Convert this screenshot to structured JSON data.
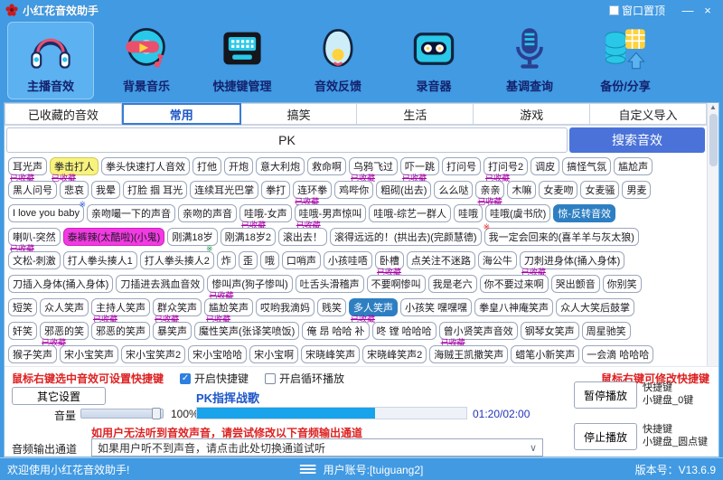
{
  "window": {
    "title": "小红花音效助手",
    "pin_label": "窗口置顶",
    "minimize_label": "—",
    "close_label": "×"
  },
  "toolbar": {
    "items": [
      {
        "label": "主播音效"
      },
      {
        "label": "背景音乐"
      },
      {
        "label": "快捷键管理"
      },
      {
        "label": "音效反馈"
      },
      {
        "label": "录音器"
      },
      {
        "label": "基调查询"
      },
      {
        "label": "备份/分享"
      }
    ]
  },
  "tabs": {
    "items": [
      {
        "label": "已收藏的音效"
      },
      {
        "label": "常用"
      },
      {
        "label": "搞笑"
      },
      {
        "label": "生活"
      },
      {
        "label": "游戏"
      },
      {
        "label": "自定义导入"
      }
    ],
    "active": "常用"
  },
  "search": {
    "value": "PK",
    "button_label": "搜索音效"
  },
  "sound_grid": {
    "badge_label": "已收藏",
    "rows": [
      [
        {
          "t": "耳光声",
          "badge": true
        },
        {
          "t": "拳击打人",
          "badge": true,
          "hl": "yellow"
        },
        {
          "t": "拳头快速打人音效"
        },
        {
          "t": "打他"
        },
        {
          "t": "开炮"
        },
        {
          "t": "意大利炮"
        },
        {
          "t": "救命啊"
        },
        {
          "t": "乌鸦飞过",
          "badge": true
        },
        {
          "t": "吓一跳",
          "badge": true
        },
        {
          "t": "打问号"
        },
        {
          "t": "打问号2",
          "badge": true
        },
        {
          "t": "调皮"
        },
        {
          "t": "搞怪气氛"
        },
        {
          "t": "尴尬声"
        }
      ],
      [
        {
          "t": "黑人问号"
        },
        {
          "t": "悲哀"
        },
        {
          "t": "我晕"
        },
        {
          "t": "打脸 掴 耳光"
        },
        {
          "t": "连续耳光巴掌"
        },
        {
          "t": "拳打"
        },
        {
          "t": "连环拳",
          "badge": true
        },
        {
          "t": "鸡哔你"
        },
        {
          "t": "粗砌(出去)"
        },
        {
          "t": "么么哒"
        },
        {
          "t": "亲亲",
          "badge": true
        },
        {
          "t": "木嘛"
        },
        {
          "t": "女麦吻"
        },
        {
          "t": "女麦骚"
        },
        {
          "t": "男麦"
        }
      ],
      [
        {
          "t": "I love you baby",
          "mark": "blue"
        },
        {
          "t": "亲吻嘬一下的声音"
        },
        {
          "t": "亲吻的声音"
        },
        {
          "t": "哇哦-女声",
          "badge": true
        },
        {
          "t": "哇哦-男声惊叫",
          "badge": true
        },
        {
          "t": "哇哦-综艺一群人"
        },
        {
          "t": "哇哦"
        },
        {
          "t": "哇哦(虞书欣)"
        },
        {
          "t": "惊-反转音效",
          "hl": "blue"
        }
      ],
      [
        {
          "t": "喇叭-突然",
          "badge": true
        },
        {
          "t": "泰裤辣(太酷啦)(小鬼)",
          "hl": "magenta"
        },
        {
          "t": "刚满18岁",
          "mark": "green"
        },
        {
          "t": "刚满18岁2"
        },
        {
          "t": "滚出去！"
        },
        {
          "t": "滚得远远的！(拱出去)(完颜慧德)"
        },
        {
          "t": "我一定会回来的(喜羊羊与灰太狼)",
          "mark": "red"
        }
      ],
      [
        {
          "t": "文松-刺激"
        },
        {
          "t": "打人拳头揍人1"
        },
        {
          "t": "打人拳头揍人2"
        },
        {
          "t": "炸"
        },
        {
          "t": "歪"
        },
        {
          "t": "哦"
        },
        {
          "t": "口哨声"
        },
        {
          "t": "小孩哇唔"
        },
        {
          "t": "卧槽",
          "badge": true
        },
        {
          "t": "点关注不迷路"
        },
        {
          "t": "海公牛"
        },
        {
          "t": "刀刺进身体(捅入身体)",
          "badge": true
        }
      ],
      [
        {
          "t": "刀插入身体(捅入身体)"
        },
        {
          "t": "刀插进去溅血音效"
        },
        {
          "t": "惨叫声(狗子惨叫)",
          "badge": true
        },
        {
          "t": "吐舌头滑稽声"
        },
        {
          "t": "不要啊惨叫"
        },
        {
          "t": "我是老六"
        },
        {
          "t": "你不要过来啊"
        },
        {
          "t": "哭出颤音"
        },
        {
          "t": "你别笑"
        }
      ],
      [
        {
          "t": "短笑"
        },
        {
          "t": "众人笑声"
        },
        {
          "t": "主持人笑声",
          "badge": true
        },
        {
          "t": "群众笑声",
          "badge": true
        },
        {
          "t": "尴尬笑声",
          "badge": true
        },
        {
          "t": "哎哟我滴妈"
        },
        {
          "t": "贱笑"
        },
        {
          "t": "多人笑声",
          "badge": true,
          "hl": "blue"
        },
        {
          "t": "小孩笑 嘿嘿嘿"
        },
        {
          "t": "拳皇八神庵笑声"
        },
        {
          "t": "众人大笑后鼓掌"
        }
      ],
      [
        {
          "t": "奸笑"
        },
        {
          "t": "邪恶的笑",
          "badge": true
        },
        {
          "t": "邪恶的笑声"
        },
        {
          "t": "暴笑声"
        },
        {
          "t": "魔性笑声(张译笑喷饭)"
        },
        {
          "t": "俺 昂 哈哈 补"
        },
        {
          "t": "咚 镗 哈哈哈"
        },
        {
          "t": "曾小贤笑声音效",
          "badge": true
        },
        {
          "t": "钢琴女笑声"
        },
        {
          "t": "周星驰笑"
        }
      ],
      [
        {
          "t": "猴子笑声"
        },
        {
          "t": "宋小宝笑声"
        },
        {
          "t": "宋小宝笑声2"
        },
        {
          "t": "宋小宝哈哈"
        },
        {
          "t": "宋小宝啊"
        },
        {
          "t": "宋晓峰笑声"
        },
        {
          "t": "宋晓峰笑声2"
        },
        {
          "t": "海贼王凯撒笑声"
        },
        {
          "t": "蜡笔小新笑声"
        },
        {
          "t": "一会滴 哈哈哈"
        }
      ]
    ]
  },
  "controls": {
    "hotkey_hint": "鼠标右键选中音效可设置快捷键",
    "enable_hotkey_label": "开启快捷键",
    "enable_hotkey_checked": "✓",
    "loop_play_label": "开启循环播放",
    "modify_hint": "鼠标右键可修改快捷键",
    "other_settings_label": "其它设置",
    "track_title": "PK指挥战歌",
    "volume_label": "音量",
    "volume_value": "100%",
    "time": "01:20/02:00",
    "progress_percent": 66,
    "warning": "如用户无法听到音效声音，请尝试修改以下音频输出通道",
    "output_channel_label": "音频输出通道",
    "output_channel_value": "如果用户听不到声音，请点击此处切换通道试听",
    "caret": "∨",
    "pause_label": "暂停播放",
    "pause_key_line1": "快捷键",
    "pause_key_line2": "小键盘_0键",
    "stop_label": "停止播放",
    "stop_key_line1": "快捷键",
    "stop_key_line2": "小键盘_圆点键"
  },
  "statusbar": {
    "welcome": "欢迎使用小红花音效助手!",
    "account": "用户账号:[tuiguang2]",
    "version": "版本号：V13.6.9"
  },
  "colors": {
    "accent_blue": "#419ae2",
    "search_button": "#4a72d8",
    "highlight_yellow": "#f7f37e",
    "highlight_magenta": "#f23ae2",
    "selected_blue": "#2e7fc2",
    "badge_purple": "#a800a8",
    "warning_red": "#dd2222",
    "progress_fill": "#18a3ea"
  }
}
